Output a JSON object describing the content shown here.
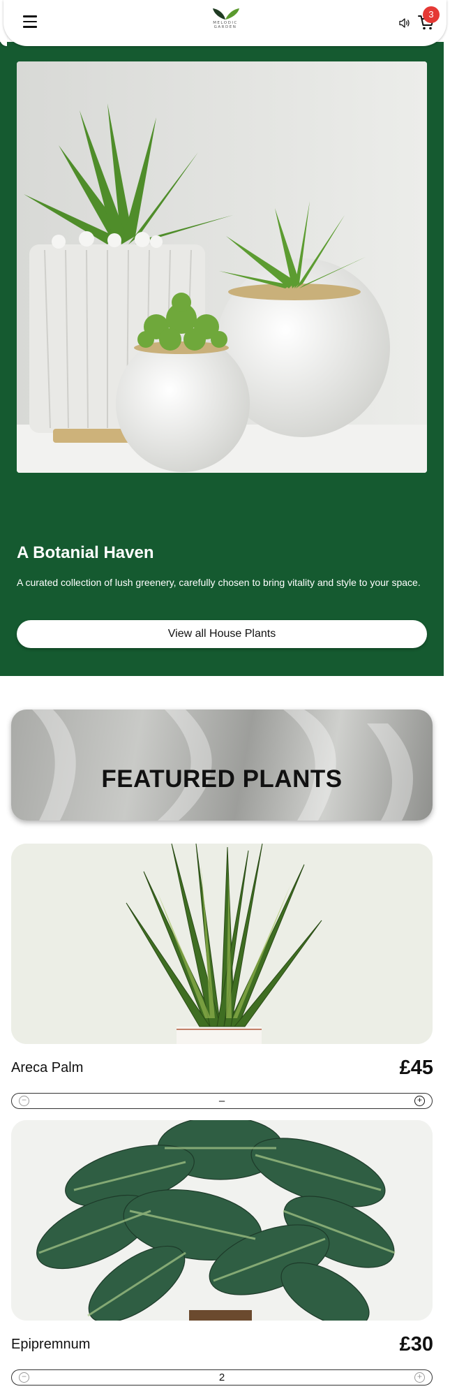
{
  "header": {
    "logo_line1": "MELODIC",
    "logo_line2": "GARDEN",
    "cart_count": "3",
    "icons": [
      "menu-icon",
      "speaker-icon",
      "cart-icon"
    ]
  },
  "hero": {
    "title": "A Botanial Haven",
    "description": "A curated collection of lush greenery, carefully chosen to bring vitality and style to your space.",
    "button_label": "View all House Plants"
  },
  "featured": {
    "title": "FEATURED PLANTS"
  },
  "products": [
    {
      "name": "Areca Palm",
      "price": "£45",
      "quantity": "–"
    },
    {
      "name": "Epipremnum",
      "price": "£30",
      "quantity": "2"
    }
  ],
  "colors": {
    "hero_bg": "#155a30",
    "badge": "#e53935",
    "text": "#111111"
  }
}
